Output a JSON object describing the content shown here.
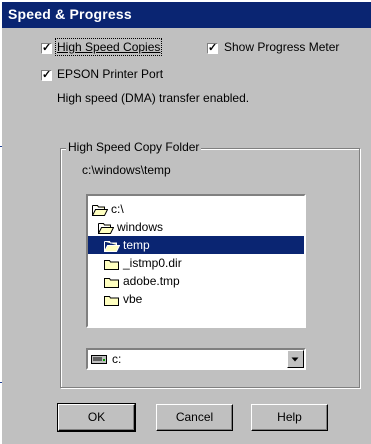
{
  "dialog": {
    "title": "Speed & Progress"
  },
  "options": {
    "high_speed_copies": {
      "label": "High Speed Copies",
      "checked": true
    },
    "show_progress_meter": {
      "label": "Show Progress Meter",
      "checked": true
    },
    "epson_printer_port": {
      "label": "EPSON Printer Port",
      "checked": true
    },
    "status_text": "High speed (DMA) transfer enabled."
  },
  "copy_folder": {
    "group_label": "High Speed Copy Folder",
    "current_path": "c:\\windows\\temp",
    "tree": [
      {
        "label": "c:\\",
        "icon": "open-folder-icon",
        "depth": 0,
        "selected": false
      },
      {
        "label": "windows",
        "icon": "open-folder-icon",
        "depth": 1,
        "selected": false
      },
      {
        "label": "temp",
        "icon": "open-folder-icon",
        "depth": 2,
        "selected": true
      },
      {
        "label": "_istmp0.dir",
        "icon": "folder-icon",
        "depth": 2,
        "selected": false
      },
      {
        "label": "adobe.tmp",
        "icon": "folder-icon",
        "depth": 2,
        "selected": false
      },
      {
        "label": "vbe",
        "icon": "folder-icon",
        "depth": 2,
        "selected": false
      }
    ],
    "drive": {
      "value": "c:",
      "icon": "hard-drive-icon"
    }
  },
  "buttons": {
    "ok": "OK",
    "cancel": "Cancel",
    "help": "Help"
  },
  "colors": {
    "title_bar": "#0a2572",
    "selection": "#0a2572",
    "face": "#c0c0c0",
    "callout_line": "#1f3f94"
  }
}
